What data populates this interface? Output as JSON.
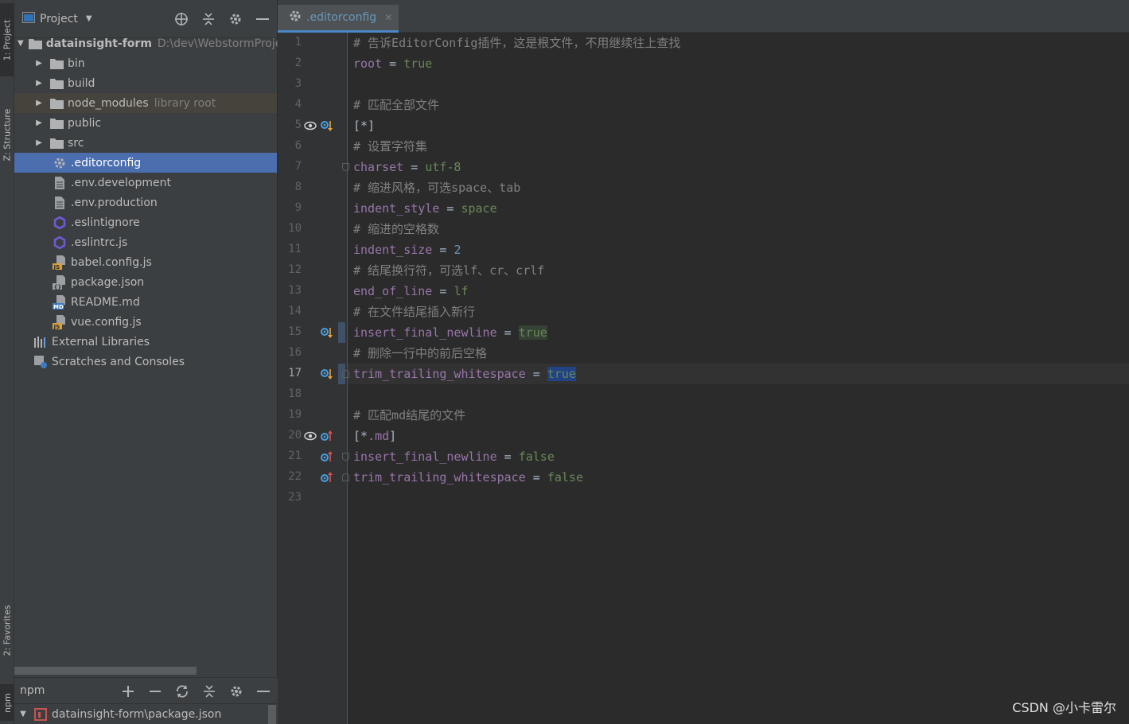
{
  "left_strip": {
    "project_label": "1: Project",
    "structure_label": "Z: Structure",
    "favorites_label": "2: Favorites",
    "npm_label": "npm"
  },
  "project_panel": {
    "title": "Project",
    "tree": [
      {
        "label": "datainsight-form",
        "extra": "D:\\dev\\WebstormProje",
        "icon": "folder-icon",
        "expanded": true
      },
      {
        "label": "bin",
        "icon": "folder-icon"
      },
      {
        "label": "build",
        "icon": "folder-icon"
      },
      {
        "label": "node_modules",
        "extra": "library root",
        "icon": "folder-icon"
      },
      {
        "label": "public",
        "icon": "folder-icon"
      },
      {
        "label": "src",
        "icon": "folder-icon"
      },
      {
        "label": ".editorconfig",
        "icon": "gear-file-icon"
      },
      {
        "label": ".env.development",
        "icon": "text-file-icon"
      },
      {
        "label": ".env.production",
        "icon": "text-file-icon"
      },
      {
        "label": ".eslintignore",
        "icon": "eslint-icon"
      },
      {
        "label": ".eslintrc.js",
        "icon": "eslint-icon"
      },
      {
        "label": "babel.config.js",
        "icon": "js-file-icon",
        "badge": "JS"
      },
      {
        "label": "package.json",
        "icon": "json-file-icon",
        "badge": "{}"
      },
      {
        "label": "README.md",
        "icon": "md-file-icon",
        "badge": "MD"
      },
      {
        "label": "vue.config.js",
        "icon": "js-file-icon",
        "badge": "JS"
      },
      {
        "label": "External Libraries",
        "icon": "libraries-icon"
      },
      {
        "label": "Scratches and Consoles",
        "icon": "scratches-icon"
      }
    ]
  },
  "npm_panel": {
    "title": "npm",
    "item": "datainsight-form\\package.json"
  },
  "editor": {
    "tab_label": ".editorconfig",
    "current_line": 17,
    "lines": [
      [
        {
          "t": "# 告诉EditorConfig插件，这是根文件，不用继续往上查找",
          "c": "cmt"
        }
      ],
      [
        {
          "t": "root",
          "c": "key"
        },
        {
          "t": " = ",
          "c": "eq"
        },
        {
          "t": "true",
          "c": "val"
        }
      ],
      [],
      [
        {
          "t": "# 匹配全部文件",
          "c": "cmt"
        }
      ],
      [
        {
          "t": "[*]",
          "c": "brk"
        }
      ],
      [
        {
          "t": "# 设置字符集",
          "c": "cmt"
        }
      ],
      [
        {
          "t": "charset",
          "c": "key"
        },
        {
          "t": " = ",
          "c": "eq"
        },
        {
          "t": "utf-8",
          "c": "val"
        }
      ],
      [
        {
          "t": "# 缩进风格，可选space、tab",
          "c": "cmt"
        }
      ],
      [
        {
          "t": "indent_style",
          "c": "key"
        },
        {
          "t": " = ",
          "c": "eq"
        },
        {
          "t": "space",
          "c": "val"
        }
      ],
      [
        {
          "t": "# 缩进的空格数",
          "c": "cmt"
        }
      ],
      [
        {
          "t": "indent_size",
          "c": "key"
        },
        {
          "t": " = ",
          "c": "eq"
        },
        {
          "t": "2",
          "c": "num"
        }
      ],
      [
        {
          "t": "# 结尾换行符，可选lf、cr、crlf",
          "c": "cmt"
        }
      ],
      [
        {
          "t": "end_of_line",
          "c": "key"
        },
        {
          "t": " = ",
          "c": "eq"
        },
        {
          "t": "lf",
          "c": "val"
        }
      ],
      [
        {
          "t": "# 在文件结尾插入新行",
          "c": "cmt"
        }
      ],
      [
        {
          "t": "insert_final_newline",
          "c": "key"
        },
        {
          "t": " = ",
          "c": "eq"
        },
        {
          "t": "true",
          "c": "val hl-green"
        }
      ],
      [
        {
          "t": "# 删除一行中的前后空格",
          "c": "cmt"
        }
      ],
      [
        {
          "t": "trim_trailing_whitespace",
          "c": "key"
        },
        {
          "t": " = ",
          "c": "eq"
        },
        {
          "t": "true",
          "c": "val hl-blue"
        }
      ],
      [],
      [
        {
          "t": "# 匹配md结尾的文件",
          "c": "cmt"
        }
      ],
      [
        {
          "t": "[*",
          "c": "brk"
        },
        {
          "t": ".md",
          "c": "key"
        },
        {
          "t": "]",
          "c": "brk"
        }
      ],
      [
        {
          "t": "insert_final_newline",
          "c": "key"
        },
        {
          "t": " = ",
          "c": "eq"
        },
        {
          "t": "false",
          "c": "val"
        }
      ],
      [
        {
          "t": "trim_trailing_whitespace",
          "c": "key"
        },
        {
          "t": " = ",
          "c": "eq"
        },
        {
          "t": "false",
          "c": "val"
        }
      ],
      []
    ],
    "gutter_icons": [
      {
        "line": 5,
        "icons": [
          "eye-icon",
          "override-down-icon"
        ]
      },
      {
        "line": 15,
        "icons": [
          "override-down-icon"
        ]
      },
      {
        "line": 17,
        "icons": [
          "override-down-icon"
        ]
      },
      {
        "line": 20,
        "icons": [
          "eye-icon",
          "override-up-icon"
        ]
      },
      {
        "line": 21,
        "icons": [
          "override-up-icon"
        ]
      },
      {
        "line": 22,
        "icons": [
          "override-up-icon"
        ]
      }
    ],
    "folds": [
      {
        "line": 7,
        "dir": "start"
      },
      {
        "line": 17,
        "dir": "end"
      },
      {
        "line": 21,
        "dir": "start"
      },
      {
        "line": 22,
        "dir": "end"
      }
    ],
    "change_marks": [
      15,
      17
    ]
  },
  "watermark": "CSDN @小卡雷尔",
  "colors": {
    "selection": "#4b6eaf",
    "keyword": "#9876aa",
    "string": "#6a8759",
    "comment": "#808080",
    "number": "#6897bb"
  }
}
